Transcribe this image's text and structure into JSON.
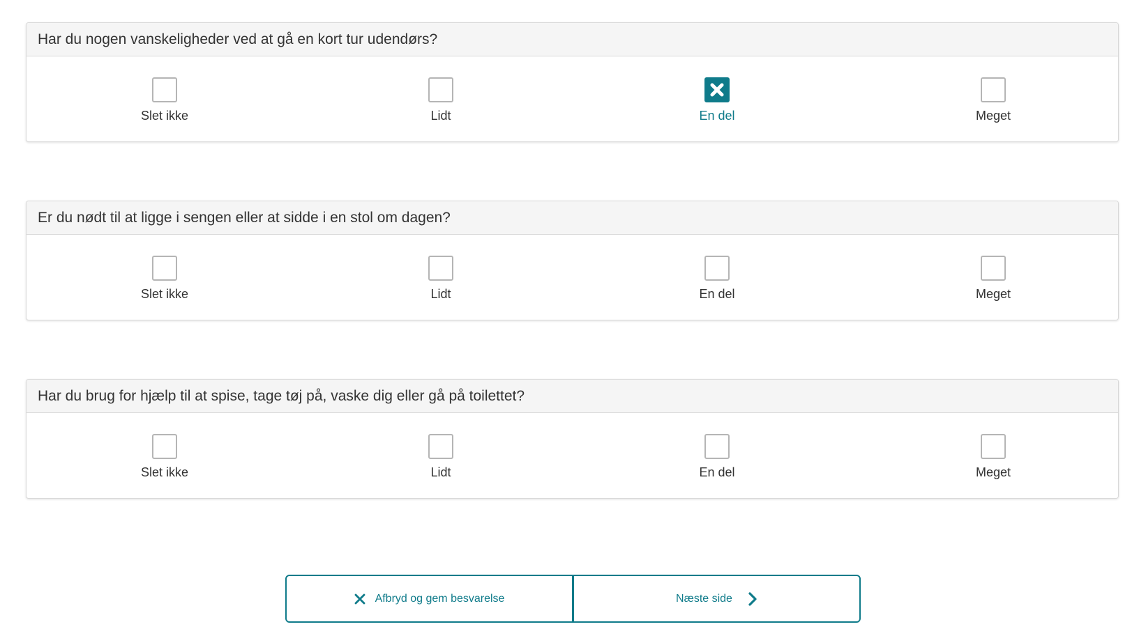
{
  "questions": [
    {
      "text": "Har du nogen vanskeligheder ved at gå en kort tur udendørs?",
      "options": [
        "Slet ikke",
        "Lidt",
        "En del",
        "Meget"
      ],
      "selected_option": "En del"
    },
    {
      "text": "Er du nødt til at ligge i sengen eller at sidde i en stol om dagen?",
      "options": [
        "Slet ikke",
        "Lidt",
        "En del",
        "Meget"
      ],
      "selected_option": null
    },
    {
      "text": "Har du brug for hjælp til at spise, tage tøj på, vaske dig eller gå på toilettet?",
      "options": [
        "Slet ikke",
        "Lidt",
        "En del",
        "Meget"
      ],
      "selected_option": null
    }
  ],
  "navigation": {
    "cancel_label": "Afbryd og gem besvarelse",
    "next_label": "Næste side",
    "cancel_icon": "close-icon",
    "next_icon": "chevron-right-icon"
  },
  "colors": {
    "accent": "#0f7b8a",
    "checkbox_border": "#b5b5b5",
    "header_bg": "#f5f5f5"
  }
}
